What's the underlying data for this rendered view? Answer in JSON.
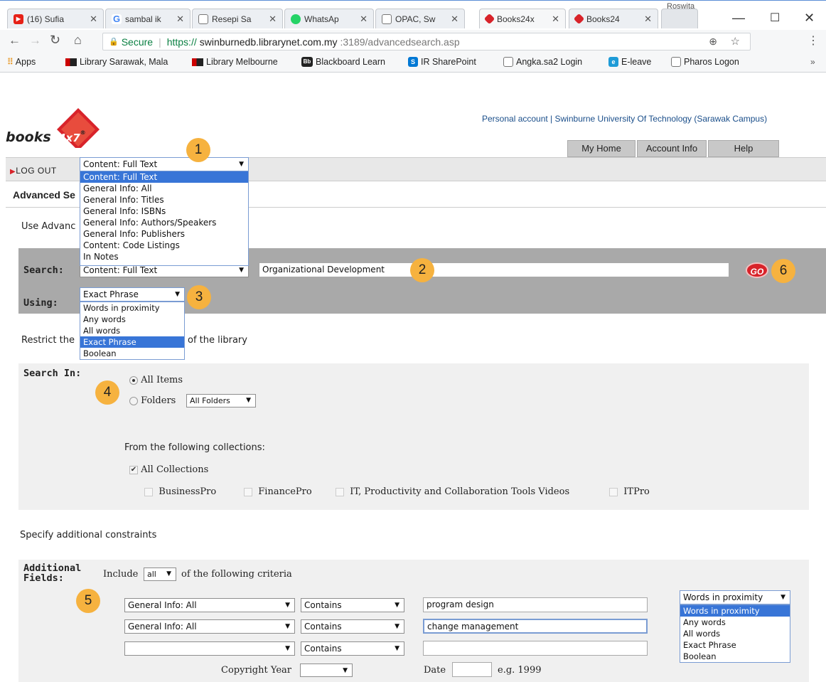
{
  "browser": {
    "profile_name": "Roswita",
    "tabs": [
      {
        "label": "(16) Sufia",
        "icon": "youtube-icon",
        "color": "#e62117"
      },
      {
        "label": "sambal ik",
        "icon": "google-icon",
        "color": "#4285f4"
      },
      {
        "label": "Resepi Sa",
        "icon": "page-icon",
        "color": "#666666"
      },
      {
        "label": "WhatsAp",
        "icon": "whatsapp-icon",
        "color": "#25d366"
      },
      {
        "label": "OPAC, Sw",
        "icon": "page-icon",
        "color": "#666666"
      },
      {
        "label": "Books24x",
        "icon": "books24x7-icon",
        "color": "#d8232a"
      },
      {
        "label": "Books24",
        "icon": "books24x7-icon",
        "color": "#d8232a"
      }
    ],
    "secure_label": "Secure",
    "url_scheme": "https://",
    "url_host": "swinburnedb.librarynet.com.my",
    "url_rest": ":3189/advancedsearch.asp",
    "bookmarks": [
      {
        "label": "Apps",
        "icon": "apps-grid-icon"
      },
      {
        "label": "Library Sarawak, Mala",
        "icon": "bookmark-flag-icon"
      },
      {
        "label": "Library Melbourne",
        "icon": "bookmark-flag-icon"
      },
      {
        "label": "Blackboard Learn",
        "icon": "blackboard-icon"
      },
      {
        "label": "IR SharePoint",
        "icon": "sharepoint-icon"
      },
      {
        "label": "Angka.sa2 Login",
        "icon": "page-icon"
      },
      {
        "label": "E-leave",
        "icon": "eleave-icon"
      },
      {
        "label": "Pharos Logon",
        "icon": "page-icon"
      }
    ],
    "overflow": "»"
  },
  "header": {
    "logo_text_main": "books",
    "logo_text_accent": "24x7",
    "logo_reg": "®",
    "account_links": "Personal account | Swinburne University Of Technology (Sarawak Campus)",
    "nav_tabs": [
      "My Home",
      "Account Info",
      "Help"
    ],
    "logout": "LOG OUT",
    "section_title": "Advanced Se",
    "intro_text": "Use Advanc"
  },
  "search": {
    "field_dropdown": {
      "selected": "Content: Full Text",
      "options": [
        "Content: Full Text",
        "General Info: All",
        "General Info: Titles",
        "General Info: ISBNs",
        "General Info: Authors/Speakers",
        "General Info: Publishers",
        "Content: Code Listings",
        "In Notes"
      ],
      "highlighted_index": 0
    },
    "search_label": "Search:",
    "field_value_behind": "Content: Full Text",
    "query_value": "Organizational Development",
    "go_label": "GO",
    "using_label": "Using:",
    "using_dropdown": {
      "selected": "Exact Phrase",
      "options": [
        "Words in proximity",
        "Any words",
        "All words",
        "Exact Phrase",
        "Boolean"
      ],
      "highlighted_index": 3
    }
  },
  "restrict": {
    "text_start": "Restrict the",
    "text_end": "of the library",
    "search_in_label": "Search In:",
    "all_items_label": "All Items",
    "folders_label": "Folders",
    "folders_select": "All Folders",
    "collections_heading": "From the following collections:",
    "all_collections_label": "All Collections",
    "collections": [
      "BusinessPro",
      "FinancePro",
      "IT, Productivity and Collaboration Tools Videos",
      "ITPro"
    ]
  },
  "constraints": {
    "heading": "Specify additional constraints",
    "additional_label_1": "Additional",
    "additional_label_2": "Fields:",
    "include_prefix": "Include",
    "include_value": "all",
    "include_suffix": "of the following criteria",
    "rows": [
      {
        "field": "General Info: All",
        "op": "Contains",
        "value": "program design"
      },
      {
        "field": "General Info: All",
        "op": "Contains",
        "value": "change management"
      },
      {
        "field": "",
        "op": "Contains",
        "value": ""
      }
    ],
    "mode_dropdown": {
      "selected": "Words in proximity",
      "options": [
        "Words in proximity",
        "Any words",
        "All words",
        "Exact Phrase",
        "Boolean"
      ],
      "highlighted_index": 0
    },
    "copyright_label": "Copyright Year",
    "date_label": "Date",
    "date_hint": "e.g. 1999"
  },
  "callouts": [
    "1",
    "2",
    "3",
    "4",
    "5",
    "6"
  ],
  "colors": {
    "accent_blue": "#3875d7",
    "badge": "#f6b23f",
    "go_red": "#d8232a",
    "search_bar_gray": "#a9a9a9"
  }
}
